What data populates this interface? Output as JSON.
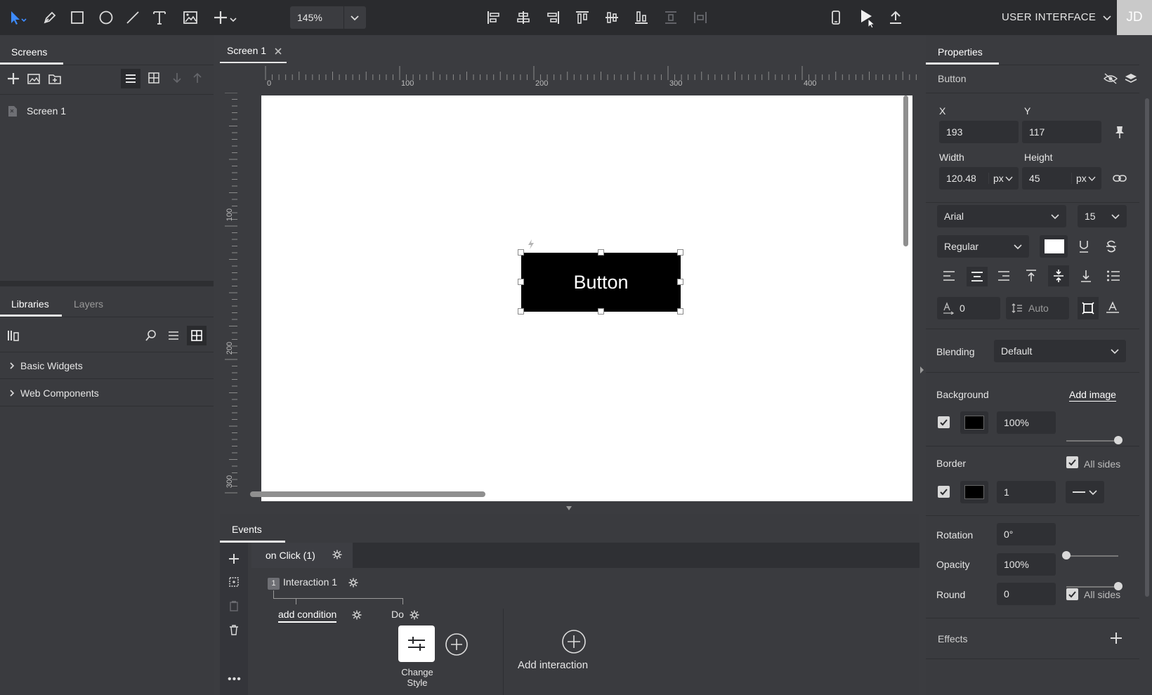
{
  "toolbar": {
    "tools": [
      "select-arrow-icon",
      "pen-icon",
      "rectangle-icon",
      "ellipse-icon",
      "line-icon",
      "text-icon",
      "image-icon",
      "add-icon"
    ],
    "zoom": "145%",
    "align_tools": [
      "align-left-icon",
      "align-center-horizontal-icon",
      "align-right-icon",
      "align-top-icon",
      "align-middle-vertical-icon",
      "align-bottom-icon",
      "distribute-vertical-icon",
      "distribute-horizontal-icon"
    ],
    "mode": "USER INTERFACE",
    "avatar": "JD"
  },
  "left_panel": {
    "screens_tab": "Screens",
    "screens": [
      {
        "label": "Screen 1"
      }
    ],
    "libraries_tab": "Libraries",
    "layers_tab": "Layers",
    "libraries": [
      {
        "label": "Basic Widgets"
      },
      {
        "label": "Web Components"
      }
    ]
  },
  "canvas": {
    "tab_label": "Screen 1",
    "ruler_h": [
      "0",
      "100",
      "200",
      "300",
      "400"
    ],
    "ruler_v": [
      "100",
      "200",
      "300"
    ],
    "button_text": "Button"
  },
  "events": {
    "tab_label": "Events",
    "event_label": "on Click (1)",
    "interaction_index": "1",
    "interaction_label": "Interaction 1",
    "add_condition": "add condition",
    "do_label": "Do",
    "action_line1": "Change",
    "action_line2": "Style",
    "add_interaction": "Add interaction"
  },
  "properties": {
    "tab_label": "Properties",
    "element_name": "Button",
    "x_label": "X",
    "x_value": "193",
    "y_label": "Y",
    "y_value": "117",
    "width_label": "Width",
    "width_value": "120.48",
    "width_unit": "px",
    "height_label": "Height",
    "height_value": "45",
    "height_unit": "px",
    "font_family": "Arial",
    "font_size": "15",
    "font_weight": "Regular",
    "letter_spacing": "0",
    "line_height": "Auto",
    "blending_label": "Blending",
    "blending_value": "Default",
    "background_label": "Background",
    "add_image": "Add image",
    "background_opacity": "100%",
    "background_opacity_fraction": 1.0,
    "border_label": "Border",
    "border_all_sides": "All sides",
    "border_width": "1",
    "rotation_label": "Rotation",
    "rotation_value": "0°",
    "rotation_fraction": 0.0,
    "opacity_label": "Opacity",
    "opacity_value": "100%",
    "opacity_fraction": 1.0,
    "round_label": "Round",
    "round_value": "0",
    "round_all_sides": "All sides",
    "effects_label": "Effects"
  },
  "colors": {
    "accent_select": "#3d8bff",
    "background_fill": "#000000",
    "border_fill": "#000000",
    "text_fill": "#ffffff"
  }
}
